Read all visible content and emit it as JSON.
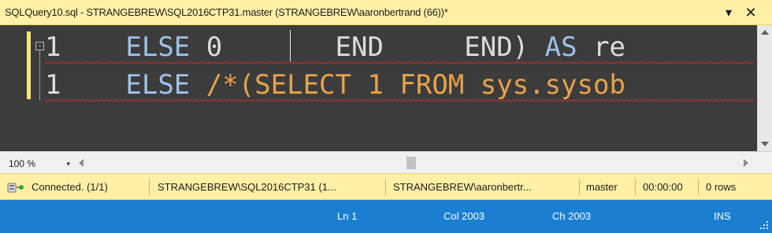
{
  "tab": {
    "title": "SQLQuery10.sql - STRANGEBREW\\SQL2016CTP31.master (STRANGEBREW\\aaronbertrand (66))*",
    "pin_glyph": "▾",
    "close_glyph": "✕"
  },
  "editor": {
    "background": "#3c3c3c",
    "fold_glyph": "-",
    "lines": [
      {
        "num": "1",
        "kw": "ELSE",
        "rest": "0       END     END)",
        "kw2": "AS",
        "tail": "re"
      },
      {
        "num": "1",
        "kw": "ELSE",
        "comment": "/*(SELECT 1 FROM sys.sysob"
      }
    ],
    "error_color": "#d03030",
    "keyword_color": "#9cc3e8",
    "comment_color": "#e8a24a"
  },
  "zoom": {
    "value": "100 %",
    "dropdown_glyph": "▾"
  },
  "query_status": {
    "connection": "Connected. (1/1)",
    "server": "STRANGEBREW\\SQL2016CTP31 (1...",
    "user": "STRANGEBREW\\aaronbertr...",
    "database": "master",
    "elapsed": "00:00:00",
    "rows": "0 rows"
  },
  "status_bar": {
    "ln": "Ln 1",
    "col": "Col 2003",
    "ch": "Ch 2003",
    "mode": "INS",
    "color": "#1a7fd1"
  }
}
